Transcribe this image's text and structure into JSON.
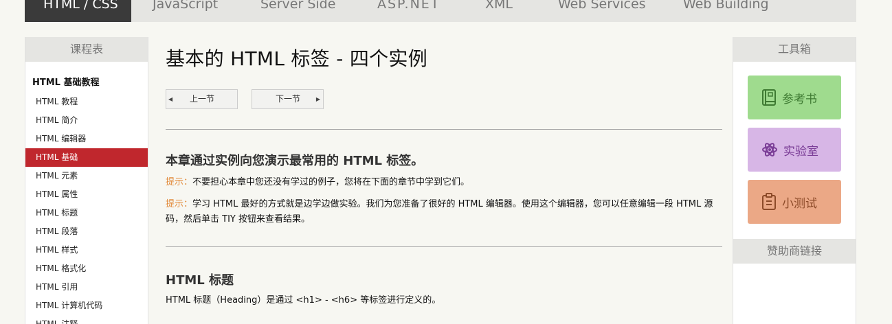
{
  "topnav": {
    "tabs": [
      {
        "label": "HTML / CSS",
        "active": true
      },
      {
        "label": "JavaScript",
        "active": false
      },
      {
        "label": "Server Side",
        "active": false
      },
      {
        "label": "ASP.NET",
        "active": false
      },
      {
        "label": "XML",
        "active": false
      },
      {
        "label": "Web Services",
        "active": false
      },
      {
        "label": "Web Building",
        "active": false
      }
    ]
  },
  "left_sidebar": {
    "heading": "课程表",
    "group_title": "HTML 基础教程",
    "items": [
      {
        "label": "HTML 教程"
      },
      {
        "label": "HTML 简介"
      },
      {
        "label": "HTML 编辑器"
      },
      {
        "label": "HTML 基础",
        "active": true
      },
      {
        "label": "HTML 元素"
      },
      {
        "label": "HTML 属性"
      },
      {
        "label": "HTML 标题"
      },
      {
        "label": "HTML 段落"
      },
      {
        "label": "HTML 样式"
      },
      {
        "label": "HTML 格式化"
      },
      {
        "label": "HTML 引用"
      },
      {
        "label": "HTML 计算机代码"
      },
      {
        "label": "HTML 注释"
      }
    ]
  },
  "main": {
    "title": "基本的 HTML 标签 - 四个实例",
    "prev_label": "上一节",
    "next_label": "下一节",
    "intro_heading": "本章通过实例向您演示最常用的 HTML 标签。",
    "tip1_label": "提示：",
    "tip1_text": "不要担心本章中您还没有学过的例子，您将在下面的章节中学到它们。",
    "tip2_label": "提示：",
    "tip2_text": "学习 HTML 最好的方式就是边学边做实验。我们为您准备了很好的 HTML 编辑器。使用这个编辑器，您可以任意编辑一段 HTML 源码，然后单击 TIY 按钮来查看结果。",
    "section_heading": "HTML 标题",
    "section_text": "HTML 标题（Heading）是通过 <h1> - <h6> 等标签进行定义的。"
  },
  "right_sidebar": {
    "heading": "工具箱",
    "tools": [
      {
        "label": "参考书",
        "icon": "book-icon",
        "color": "#9fdb8e"
      },
      {
        "label": "实验室",
        "icon": "atom-icon",
        "color": "#d7b6e6"
      },
      {
        "label": "小测试",
        "icon": "clipboard-icon",
        "color": "#eba886"
      }
    ],
    "sponsor_heading": "赞助商链接"
  },
  "colors": {
    "active_item": "#c0272d",
    "tip_label": "#e28a3a",
    "nav_active": "#3a3a3a"
  }
}
